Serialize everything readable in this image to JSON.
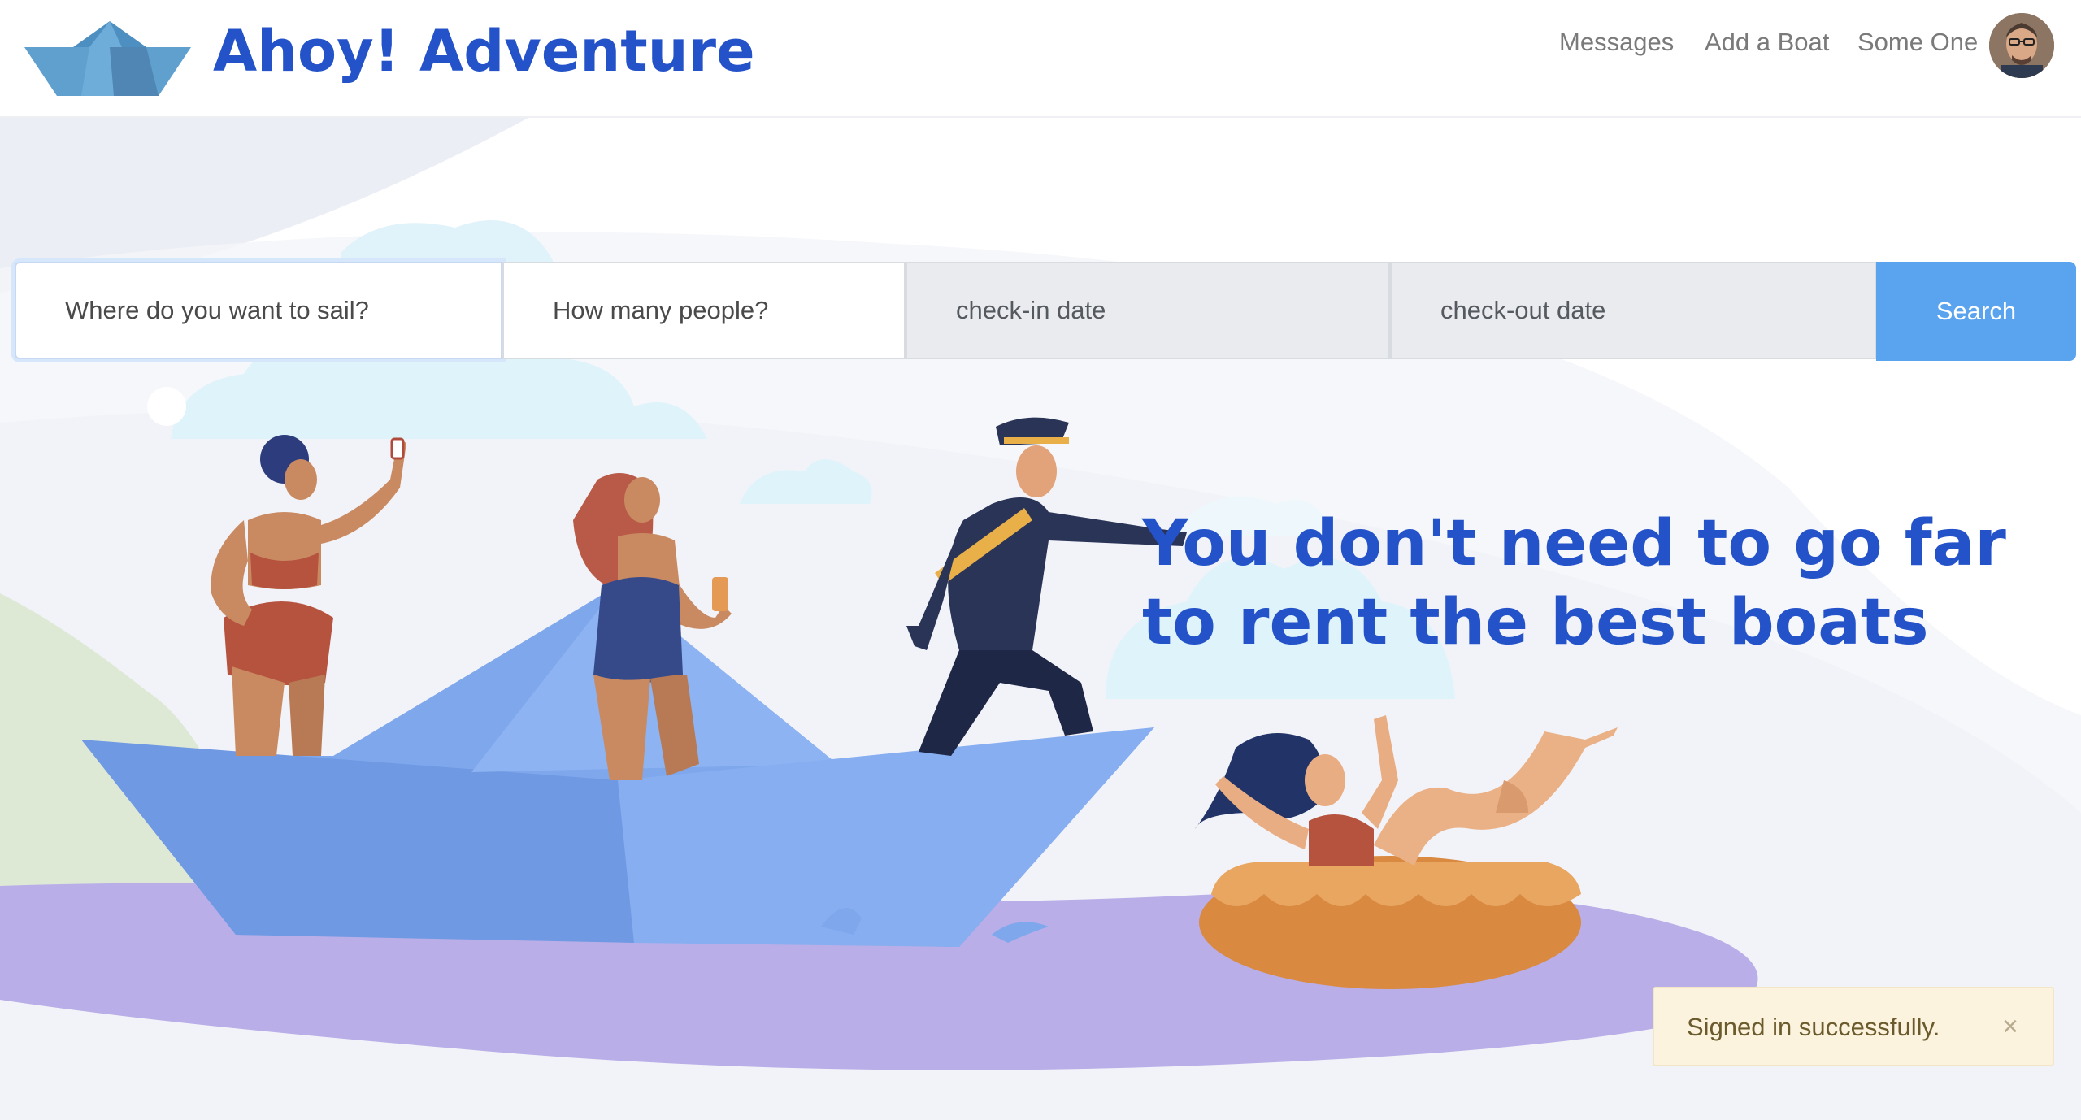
{
  "brand": {
    "name": "Ahoy! Adventure",
    "logo_icon": "paper-boat-icon"
  },
  "nav": {
    "messages": "Messages",
    "add_boat": "Add a Boat",
    "user_name": "Some One",
    "avatar_icon": "user-avatar"
  },
  "search": {
    "destination_placeholder": "Where do you want to sail?",
    "people_placeholder": "How many people?",
    "checkin_placeholder": "check-in date",
    "checkout_placeholder": "check-out date",
    "button_label": "Search"
  },
  "hero": {
    "tagline_line1": "You don't need to go far",
    "tagline_line2": "to rent the best boats"
  },
  "flash": {
    "message": "Signed in successfully.",
    "close_glyph": "×"
  },
  "colors": {
    "brand_blue": "#2453c9",
    "search_button": "#5aa4ef",
    "flash_bg": "#fcf3de",
    "water": "#b9aee8",
    "boat": "#7da6ec"
  }
}
